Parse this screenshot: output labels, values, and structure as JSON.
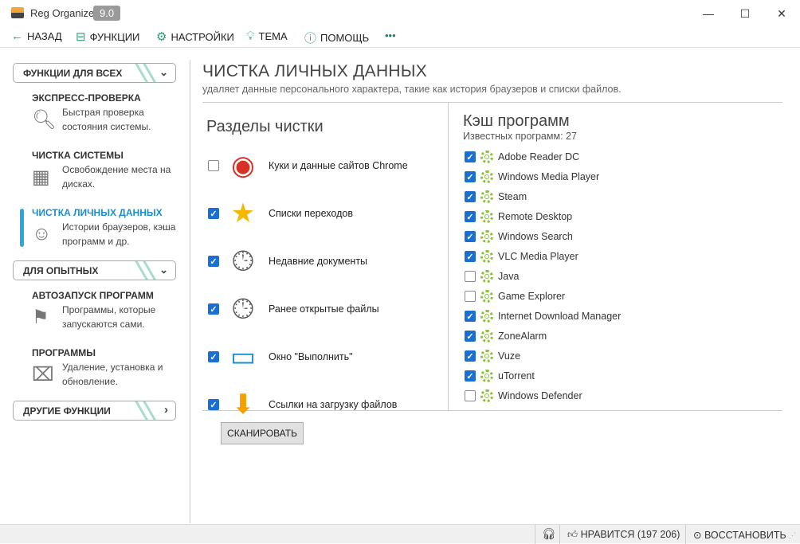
{
  "app": {
    "title": "Reg Organizer",
    "version": "9.0",
    "minimize": "—",
    "maximize": "☐",
    "close": "✕"
  },
  "toolbar": {
    "back": "НАЗАД",
    "functions": "ФУНКЦИИ",
    "settings": "НАСТРОЙКИ",
    "theme": "ТЕМА",
    "help": "ПОМОЩЬ",
    "more": "•••"
  },
  "sidebar": {
    "group1": "ФУНКЦИИ ДЛЯ ВСЕХ",
    "express": {
      "title": "ЭКСПРЕСС-ПРОВЕРКА",
      "desc": "Быстрая проверка состояния системы."
    },
    "system": {
      "title": "ЧИСТКА СИСТЕМЫ",
      "desc": "Освобождение места на дисках."
    },
    "personal": {
      "title": "ЧИСТКА ЛИЧНЫХ ДАННЫХ",
      "desc": "Истории браузеров, кэша программ и др."
    },
    "group2": "ДЛЯ ОПЫТНЫХ",
    "autorun": {
      "title": "АВТОЗАПУСК ПРОГРАММ",
      "desc": "Программы, которые запускаются сами."
    },
    "programs": {
      "title": "ПРОГРАММЫ",
      "desc": "Удаление, установка и обновление."
    },
    "group3": "ДРУГИЕ ФУНКЦИИ"
  },
  "main": {
    "title": "ЧИСТКА ЛИЧНЫХ ДАННЫХ",
    "subtitle": "удаляет данные персонального характера, такие как история браузеров и списки файлов.",
    "sections_title": "Разделы чистки",
    "sections": [
      {
        "label": "Куки и данные сайтов Chrome",
        "checked": false,
        "icon": "chrome-icon"
      },
      {
        "label": "Списки переходов",
        "checked": true,
        "icon": "jumplist-star-icon"
      },
      {
        "label": "Недавние документы",
        "checked": true,
        "icon": "recent-documents-icon"
      },
      {
        "label": "Ранее открытые файлы",
        "checked": true,
        "icon": "recent-files-icon"
      },
      {
        "label": "Окно \"Выполнить\"",
        "checked": true,
        "icon": "run-dialog-icon"
      },
      {
        "label": "Ссылки на загрузку файлов",
        "checked": true,
        "icon": "download-icon"
      }
    ],
    "cache_title": "Кэш программ",
    "known_programs": "Известных программ: 27",
    "programs": [
      {
        "label": "Adobe Reader DC",
        "checked": true
      },
      {
        "label": "Windows Media Player",
        "checked": true
      },
      {
        "label": "Steam",
        "checked": true
      },
      {
        "label": "Remote Desktop",
        "checked": true
      },
      {
        "label": "Windows Search",
        "checked": true
      },
      {
        "label": "VLC Media Player",
        "checked": true
      },
      {
        "label": "Java",
        "checked": false
      },
      {
        "label": "Game Explorer",
        "checked": false
      },
      {
        "label": "Internet Download Manager",
        "checked": true
      },
      {
        "label": "ZoneAlarm",
        "checked": true
      },
      {
        "label": "Vuze",
        "checked": true
      },
      {
        "label": "uTorrent",
        "checked": true
      },
      {
        "label": "Windows Defender",
        "checked": false
      }
    ],
    "scan_button": "СКАНИРОВАТЬ"
  },
  "status": {
    "likes": "НРАВИТСЯ (197 206)",
    "restore": "ВОССТАНОВИТЬ"
  },
  "colors": {
    "accent": "#1a8fd0",
    "checkbox": "#1a6fd0",
    "toolbar_icon": "#2e9a78",
    "gear": "#8cbf3a"
  }
}
